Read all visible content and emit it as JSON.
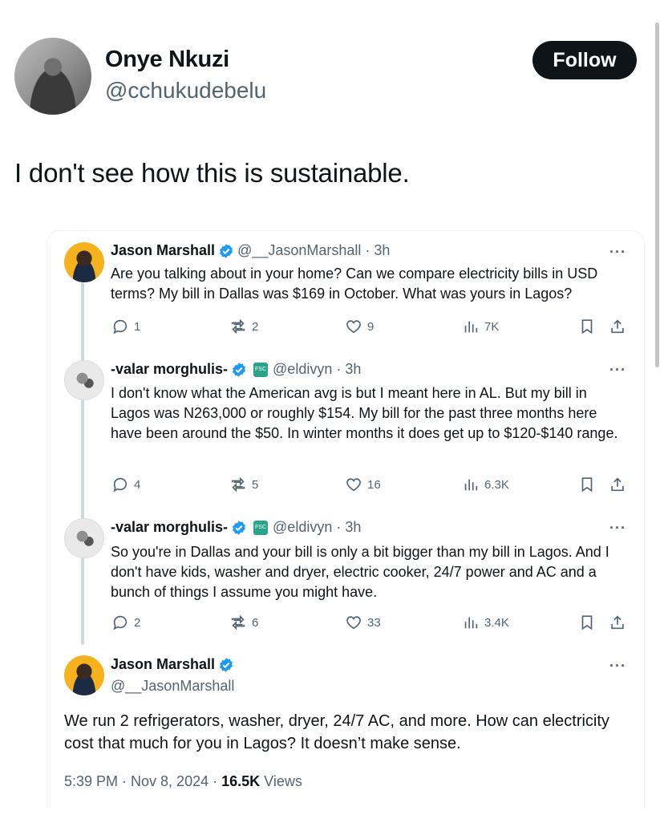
{
  "author": {
    "name": "Onye Nkuzi",
    "handle": "@cchukudebelu",
    "follow_label": "Follow"
  },
  "post_text": "I don't see how this is sustainable.",
  "quoted_thread": [
    {
      "name": "Jason Marshall",
      "handle": "@__JasonMarshall",
      "time": "· 3h",
      "text": "Are you talking about in your home? Can we compare electricity bills in USD terms? My bill in Dallas was $169 in October. What was yours in Lagos?",
      "replies": "1",
      "reposts": "2",
      "likes": "9",
      "views": "7K"
    },
    {
      "name": "-valar morghulis-",
      "handle": "@eldivyn",
      "time": "· 3h",
      "text": "I don't know what the American avg is but I meant here in AL. But my bill in Lagos was N263,000 or roughly $154. My bill for the past three months here have been around the $50. In winter months it does get up to $120-$140 range.",
      "replies": "4",
      "reposts": "5",
      "likes": "16",
      "views": "6.3K"
    },
    {
      "name": "-valar morghulis-",
      "handle": "@eldivyn",
      "time": "· 3h",
      "text": "So you're in Dallas and your bill is only a bit bigger than my bill in Lagos. And I don't have kids, washer and dryer, electric cooker, 24/7 power and AC and a bunch of things I assume you might have.",
      "replies": "2",
      "reposts": "6",
      "likes": "33",
      "views": "3.4K"
    }
  ],
  "final_post": {
    "name": "Jason Marshall",
    "handle": "@__JasonMarshall",
    "text": "We run 2 refrigerators, washer, dryer, 24/7 AC, and more. How can electricity cost that much for you in Lagos? It doesn’t make sense.",
    "time": "5:39 PM · Nov 8, 2024 · ",
    "views_count": "16.5K",
    "views_label": " Views"
  },
  "more_label": "···",
  "affiliate_badge": "FSC",
  "colors": {
    "text": "#0f1419",
    "secondary": "#536471",
    "verified": "#1d9bf0",
    "follow_bg": "#0f1419",
    "thread_line": "#cfd9de",
    "affiliate": "#2aa38a"
  }
}
